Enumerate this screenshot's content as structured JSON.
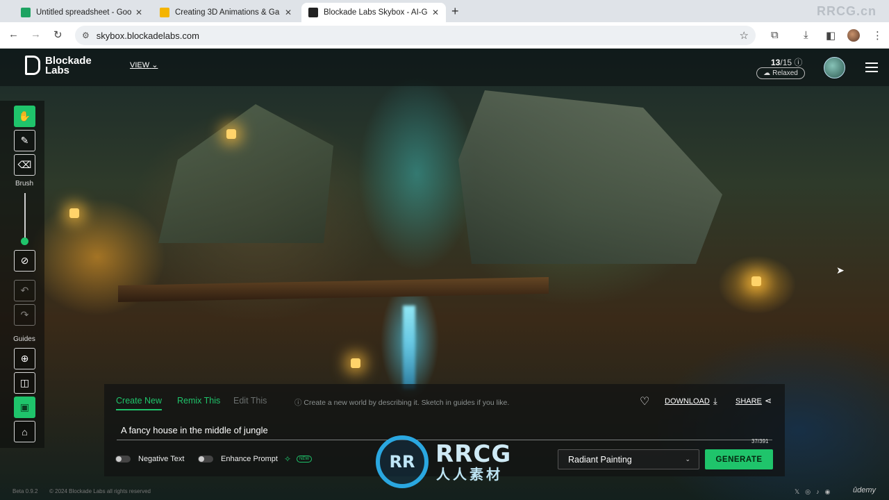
{
  "browser": {
    "tabs": [
      {
        "title": "Untitled spreadsheet - Google",
        "favicon_color": "#1ea362"
      },
      {
        "title": "Creating 3D Animations & Ga",
        "favicon_color": "#f4b400"
      },
      {
        "title": "Blockade Labs Skybox - AI-G",
        "favicon_color": "#222222"
      }
    ],
    "new_tab": "+",
    "corner_watermark": "RRCG.cn",
    "url": "skybox.blockadelabs.com"
  },
  "app": {
    "logo_line1": "Blockade",
    "logo_line2": "Labs",
    "view_label": "VIEW",
    "credits_used": "13",
    "credits_total": "/15",
    "mode_badge": "Relaxed"
  },
  "toolbar": {
    "brush_label": "Brush",
    "brush_size_fraction": 0.05,
    "guides_label": "Guides"
  },
  "panel": {
    "tabs": [
      "Create New",
      "Remix This",
      "Edit This"
    ],
    "hint": "Create a new world by describing it. Sketch in guides if you like.",
    "download_label": "DOWNLOAD",
    "share_label": "SHARE",
    "prompt_value": "A fancy house in the middle of jungle",
    "char_counter": "37/391",
    "negative_text_label": "Negative Text",
    "enhance_prompt_label": "Enhance Prompt",
    "new_badge": "NEW",
    "style_value": "Radiant Painting",
    "generate_label": "GENERATE"
  },
  "watermark": {
    "logo_letters": "RR",
    "text": "RRCG",
    "sub": "人人素材"
  },
  "footer": {
    "version": "Beta 0.9.2",
    "copyright": "© 2024 Blockade Labs all rights reserved",
    "udemy": "ûdemy"
  },
  "colors": {
    "accent": "#1fc46b"
  }
}
